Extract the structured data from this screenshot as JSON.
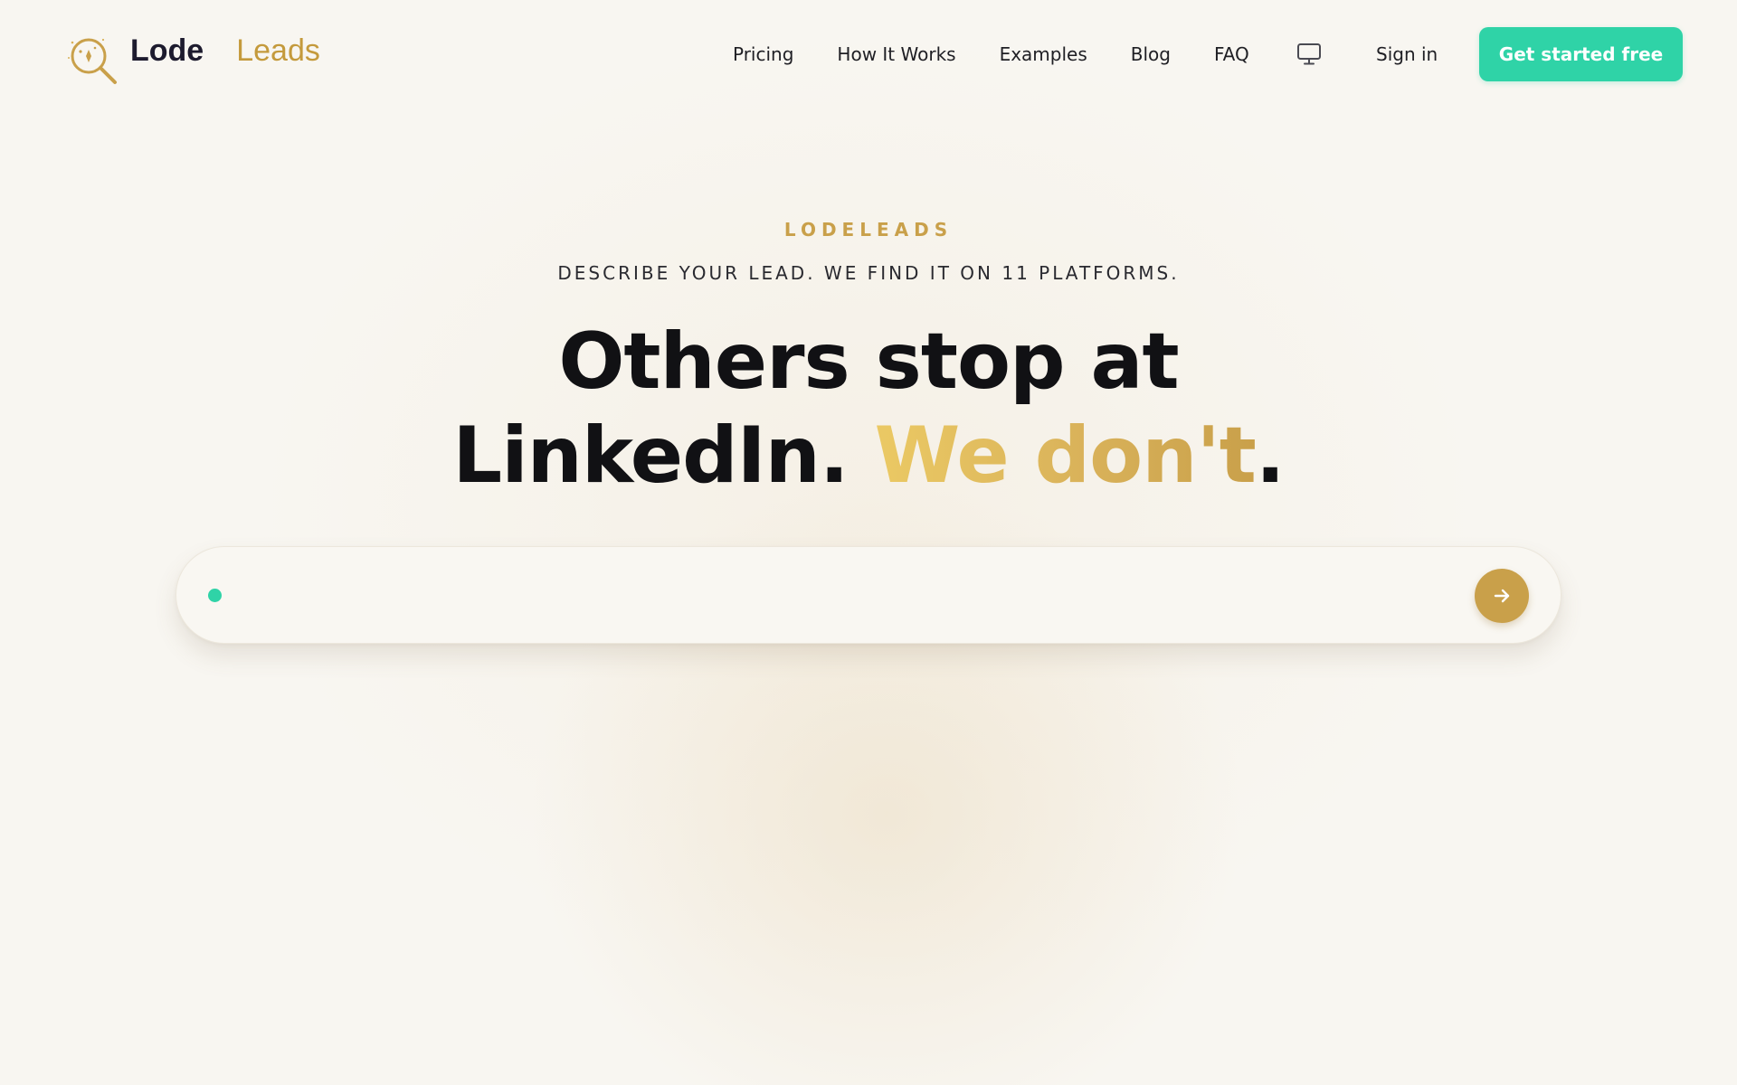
{
  "brand": {
    "name_part_1": "Lode",
    "name_part_2": "Leads",
    "logo_icon": "magnifier-sparkle-icon"
  },
  "nav": {
    "links": [
      {
        "label": "Pricing"
      },
      {
        "label": "How It Works"
      },
      {
        "label": "Examples"
      },
      {
        "label": "Blog"
      },
      {
        "label": "FAQ"
      }
    ],
    "display_toggle_icon": "monitor-icon",
    "sign_in_label": "Sign in",
    "cta_label": "Get started free"
  },
  "hero": {
    "eyebrow": "LODELEADS",
    "tagline": "DESCRIBE YOUR LEAD. WE FIND IT ON 11 PLATFORMS.",
    "headline_line_1": "Others stop at",
    "headline_line_2_plain": "LinkedIn.",
    "headline_line_2_accent": "We don't",
    "headline_line_2_end": "."
  },
  "search": {
    "value": "",
    "placeholder": "",
    "submit_icon": "arrow-right-icon"
  },
  "colors": {
    "background": "#f8f6f1",
    "brand_dark": "#1d1b2e",
    "gold": "#c9a04a",
    "gold_light": "#ebc964",
    "mint": "#2fd3a7"
  }
}
